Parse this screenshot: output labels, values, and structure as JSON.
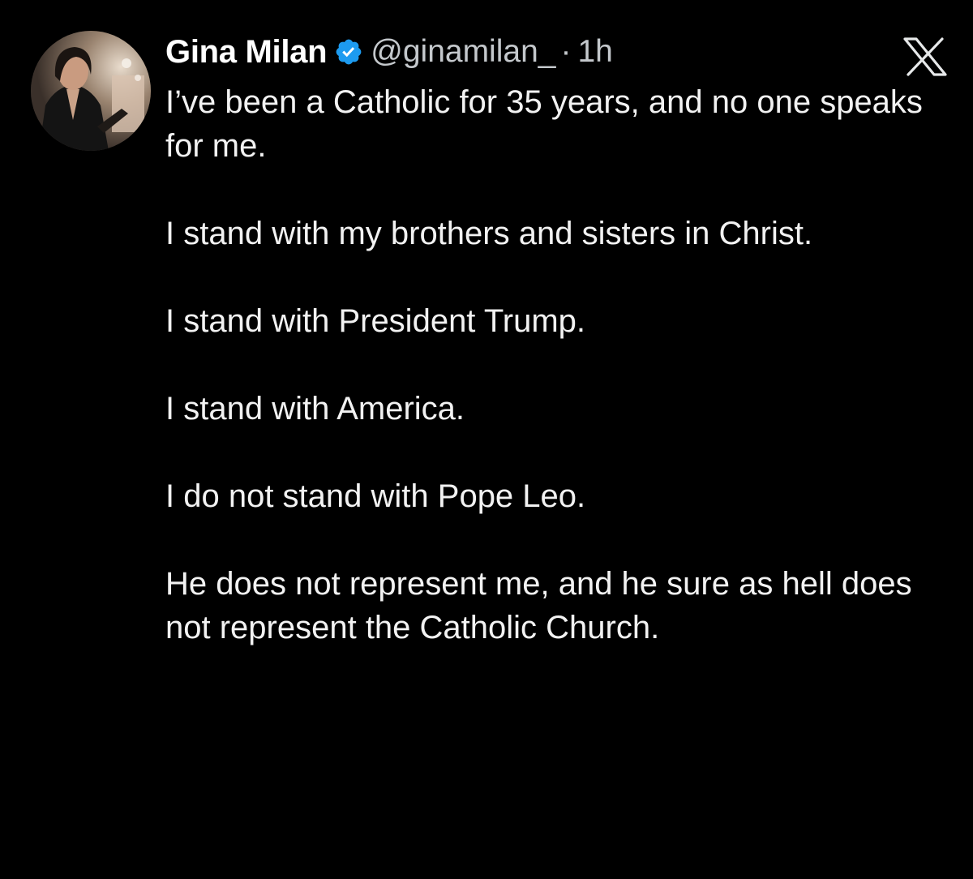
{
  "post": {
    "author": {
      "display_name": "Gina Milan",
      "handle": "@ginamilan_",
      "verified": true,
      "avatar_icon": "profile-photo"
    },
    "separator": "·",
    "timestamp": "1h",
    "platform_icon": "x-logo-icon",
    "paragraphs": [
      "I’ve been a Catholic for 35 years, and no one speaks for me.",
      "I stand with my brothers and sisters in Christ.",
      "I stand with President Trump.",
      "I stand with America.",
      "I do not stand with Pope Leo.",
      "He does not represent me, and he sure as hell does not represent the Catholic Church."
    ]
  },
  "colors": {
    "background": "#000000",
    "text": "#f2f2f2",
    "secondary_text": "#c4c8cc",
    "verified_badge": "#1d9bf0"
  }
}
